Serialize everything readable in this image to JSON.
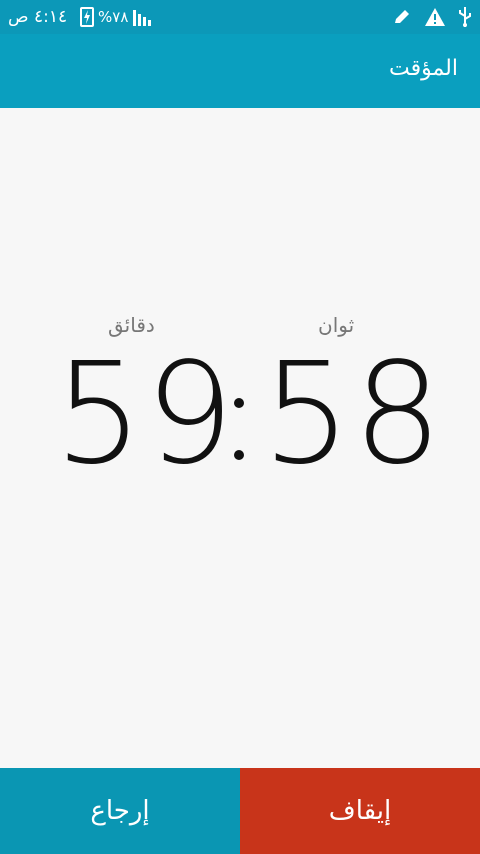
{
  "status_bar": {
    "time": "٤:١٤ ص",
    "battery_percent": "%٧٨",
    "battery_level_fraction": 0.78,
    "icons": [
      "battery-icon",
      "signal-icon",
      "edit-icon",
      "warning-icon",
      "usb-icon"
    ]
  },
  "app_bar": {
    "title": "المؤقت"
  },
  "timer": {
    "minutes_label": "دقائق",
    "seconds_label": "ثوان",
    "minutes": "59",
    "seconds": "58"
  },
  "buttons": {
    "reset_label": "إرجاع",
    "stop_label": "إيقاف"
  },
  "colors": {
    "status_bar": "#0c98b8",
    "app_bar": "#0a9fbf",
    "reset": "#0a96b3",
    "stop": "#c8341a",
    "background": "#f7f7f7"
  }
}
